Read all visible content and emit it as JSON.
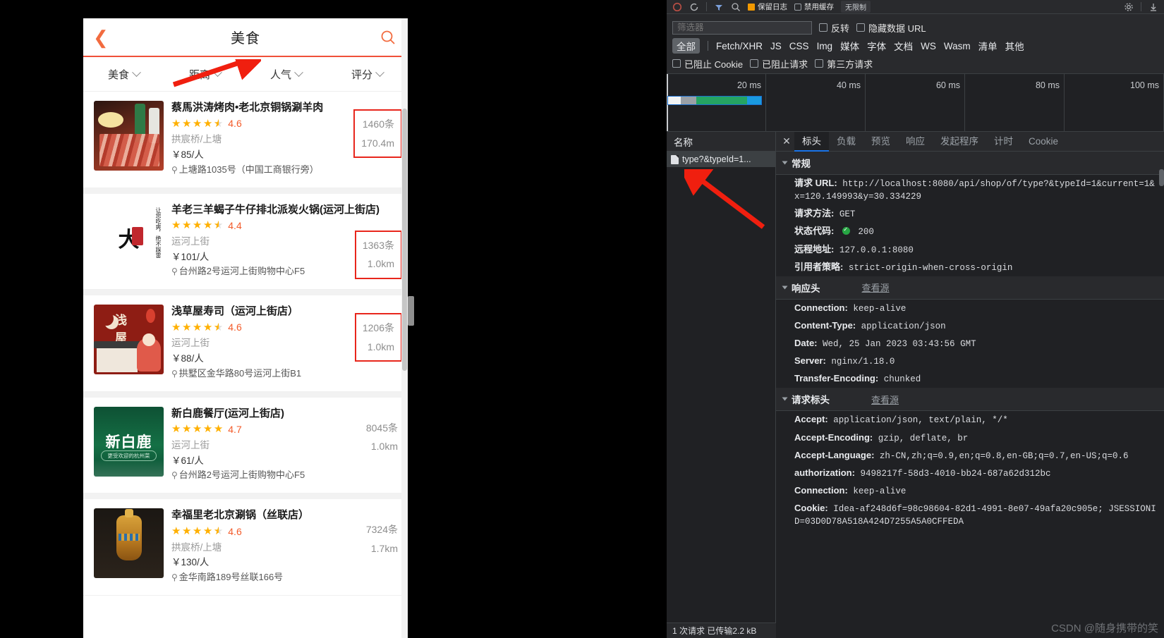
{
  "phone": {
    "nav": {
      "back_icon": "chevron-left-icon",
      "title": "美食",
      "search_icon": "search-icon"
    },
    "filters": [
      {
        "label": "美食",
        "icon": "chevron-down-icon"
      },
      {
        "label": "距离",
        "icon": "chevron-down-icon"
      },
      {
        "label": "人气",
        "icon": "chevron-down-icon"
      },
      {
        "label": "评分",
        "icon": "chevron-down-icon"
      }
    ],
    "shops": [
      {
        "name": "蔡馬洪涛烤肉•老北京铜锅涮羊肉",
        "score": "4.6",
        "stars_full": 4,
        "stars_half": true,
        "area": "拱宸桥/上塘",
        "price": "￥85/人",
        "address": "上塘路1035号（中国工商银行旁）",
        "comments": "1460条",
        "distance": "170.4m",
        "highlighted": true
      },
      {
        "name": "羊老三羊蝎子牛仔排北派炭火锅(运河上街店)",
        "score": "4.4",
        "stars_full": 4,
        "stars_half": true,
        "area": "运河上街",
        "price": "￥101/人",
        "address": "台州路2号运河上街购物中心F5",
        "comments": "1363条",
        "distance": "1.0km",
        "highlighted": true
      },
      {
        "name": "浅草屋寿司（运河上街店）",
        "score": "4.6",
        "stars_full": 4,
        "stars_half": true,
        "area": "运河上街",
        "price": "￥88/人",
        "address": "拱墅区金华路80号运河上街B1",
        "comments": "1206条",
        "distance": "1.0km",
        "highlighted": true
      },
      {
        "name": "新白鹿餐厅(运河上街店)",
        "score": "4.7",
        "stars_full": 5,
        "stars_half": false,
        "area": "运河上街",
        "price": "￥61/人",
        "address": "台州路2号运河上街购物中心F5",
        "comments": "8045条",
        "distance": "1.0km",
        "highlighted": false
      },
      {
        "name": "幸福里老北京涮锅（丝联店）",
        "score": "4.6",
        "stars_full": 4,
        "stars_half": true,
        "area": "拱宸桥/上塘",
        "price": "￥130/人",
        "address": "金华南路189号丝联166号",
        "comments": "7324条",
        "distance": "1.7km",
        "highlighted": false
      }
    ]
  },
  "devtools": {
    "toolbar": {
      "record_icon": "record-stop-icon",
      "clear_icon": "clear-icon",
      "filter_icon": "filter-icon",
      "search_icon": "search-icon",
      "preserve_log_label": "保留日志",
      "disable_cache_label": "禁用缓存",
      "throttling_label": "无限制",
      "settings_icon": "gear-icon",
      "import_icon": "import-icon",
      "export_icon": "export-icon"
    },
    "filterbar": {
      "filter_placeholder": "筛选器",
      "invert_label": "反转",
      "hide_data_urls_label": "隐藏数据 URL",
      "types": [
        "全部",
        "Fetch/XHR",
        "JS",
        "CSS",
        "Img",
        "媒体",
        "字体",
        "文档",
        "WS",
        "Wasm",
        "清单",
        "其他"
      ],
      "blocked_cookies_label": "已阻止 Cookie",
      "blocked_requests_label": "已阻止请求",
      "third_party_label": "第三方请求"
    },
    "overview": {
      "ticks": [
        "20 ms",
        "40 ms",
        "60 ms",
        "80 ms",
        "100 ms"
      ]
    },
    "requests": {
      "column_header": "名称",
      "rows": [
        {
          "name": "type?&typeId=1...",
          "icon": "document-icon"
        }
      ],
      "status_bar": "1 次请求 已传输2.2 kB"
    },
    "detail": {
      "close_icon": "close-icon",
      "tabs": [
        "标头",
        "负载",
        "预览",
        "响应",
        "发起程序",
        "计时",
        "Cookie"
      ],
      "active_tab": "标头",
      "view_source_label": "查看源",
      "sections": [
        {
          "title": "常规",
          "link": "",
          "items": [
            {
              "key": "请求 URL:",
              "value": "http://localhost:8080/api/shop/of/type?&typeId=1&current=1&x=120.149993&y=30.334229"
            },
            {
              "key": "请求方法:",
              "value": "GET"
            },
            {
              "key": "状态代码:",
              "value": "200",
              "status_ok": true
            },
            {
              "key": "远程地址:",
              "value": "127.0.0.1:8080"
            },
            {
              "key": "引用者策略:",
              "value": "strict-origin-when-cross-origin"
            }
          ]
        },
        {
          "title": "响应头",
          "link": "查看源",
          "items": [
            {
              "key": "Connection:",
              "value": "keep-alive"
            },
            {
              "key": "Content-Type:",
              "value": "application/json"
            },
            {
              "key": "Date:",
              "value": "Wed, 25 Jan 2023 03:43:56 GMT"
            },
            {
              "key": "Server:",
              "value": "nginx/1.18.0"
            },
            {
              "key": "Transfer-Encoding:",
              "value": "chunked"
            }
          ]
        },
        {
          "title": "请求标头",
          "link": "查看源",
          "items": [
            {
              "key": "Accept:",
              "value": "application/json, text/plain, */*"
            },
            {
              "key": "Accept-Encoding:",
              "value": "gzip, deflate, br"
            },
            {
              "key": "Accept-Language:",
              "value": "zh-CN,zh;q=0.9,en;q=0.8,en-GB;q=0.7,en-US;q=0.6"
            },
            {
              "key": "authorization:",
              "value": "9498217f-58d3-4010-bb24-687a62d312bc"
            },
            {
              "key": "Connection:",
              "value": "keep-alive"
            },
            {
              "key": "Cookie:",
              "value": "Idea-af248d6f=98c98604-82d1-4991-8e07-49afa20c905e; JSESSIONID=03D0D78A518A424D7255A5A0CFFEDA"
            }
          ]
        }
      ]
    },
    "watermark": "CSDN @随身携带的笑"
  },
  "colors": {
    "accent_orange": "#f0503a",
    "star_gold": "#ffb000",
    "annotation_red": "#e8261c",
    "devtools_bg": "#202124",
    "tab_active_blue": "#1a73e8"
  }
}
